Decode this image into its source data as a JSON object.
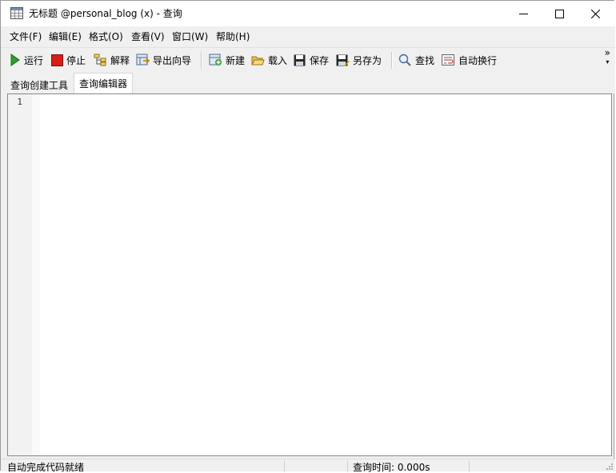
{
  "window": {
    "title": "无标题 @personal_blog (x) - 查询"
  },
  "menu": [
    {
      "label": "文件(F)"
    },
    {
      "label": "编辑(E)"
    },
    {
      "label": "格式(O)"
    },
    {
      "label": "查看(V)"
    },
    {
      "label": "窗口(W)"
    },
    {
      "label": "帮助(H)"
    }
  ],
  "toolbar": {
    "run": "运行",
    "stop": "停止",
    "explain": "解释",
    "export": "导出向导",
    "new": "新建",
    "load": "载入",
    "save": "保存",
    "save_as": "另存为",
    "find": "查找",
    "word_wrap": "自动换行",
    "overflow": "»"
  },
  "tabs": [
    {
      "label": "查询创建工具",
      "active": false
    },
    {
      "label": "查询编辑器",
      "active": true
    }
  ],
  "editor": {
    "line_numbers": [
      "1"
    ],
    "content": ""
  },
  "status": {
    "autocomplete": "自动完成代码就绪",
    "query_time": "查询时间: 0.000s"
  },
  "colors": {
    "run_green": "#2e9c2e",
    "stop_red": "#d91e18",
    "border": "#828790",
    "bar_bg": "#f0f0f0"
  }
}
